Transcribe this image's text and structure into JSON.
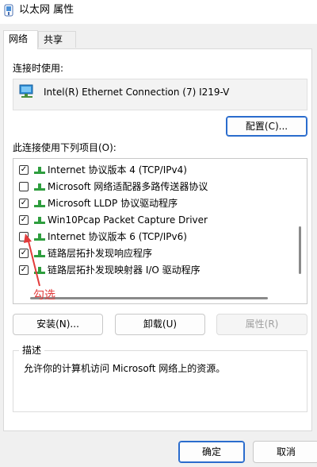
{
  "window": {
    "title": "以太网 属性"
  },
  "tabs": [
    {
      "label": "网络",
      "active": true
    },
    {
      "label": "共享",
      "active": false
    }
  ],
  "connect_using": {
    "label": "连接时使用:",
    "adapter_name": "Intel(R) Ethernet Connection (7) I219-V",
    "adapter_icon": "network-adapter-icon",
    "configure_button": "配置(C)..."
  },
  "items_label": "此连接使用下列项目(O):",
  "items": [
    {
      "label": "Internet 协议版本 4 (TCP/IPv4)",
      "checked": true,
      "icon": "protocol-icon"
    },
    {
      "label": "Microsoft 网络适配器多路传送器协议",
      "checked": false,
      "icon": "protocol-icon"
    },
    {
      "label": "Microsoft LLDP 协议驱动程序",
      "checked": true,
      "icon": "protocol-icon"
    },
    {
      "label": "Win10Pcap Packet Capture Driver",
      "checked": true,
      "icon": "protocol-icon"
    },
    {
      "label": "Internet 协议版本 6 (TCP/IPv6)",
      "checked": false,
      "icon": "protocol-icon"
    },
    {
      "label": "链路层拓扑发现响应程序",
      "checked": true,
      "icon": "protocol-icon"
    },
    {
      "label": "链路层拓扑发现映射器 I/O 驱动程序",
      "checked": true,
      "icon": "protocol-icon"
    }
  ],
  "annotation": {
    "text": "勾选",
    "color": "#e23b3b"
  },
  "buttons": {
    "install": "安装(N)...",
    "uninstall": "卸载(U)",
    "properties": "属性(R)",
    "ok": "确定",
    "cancel": "取消"
  },
  "description": {
    "legend": "描述",
    "text": "允许你的计算机访问 Microsoft 网络上的资源。"
  },
  "colors": {
    "accent": "#2a6ccd",
    "protocol_icon": "#2e9e3e"
  }
}
